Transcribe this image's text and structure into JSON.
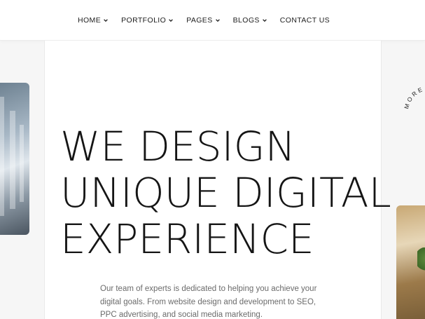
{
  "nav": {
    "items": [
      {
        "label": "HOME",
        "has_dropdown": true
      },
      {
        "label": "PORTFOLIO",
        "has_dropdown": true
      },
      {
        "label": "PAGES",
        "has_dropdown": true
      },
      {
        "label": "BLOGS",
        "has_dropdown": true
      },
      {
        "label": "CONTACT US",
        "has_dropdown": false
      }
    ]
  },
  "hero": {
    "title_line1": "WE DESIGN",
    "title_line2": "UNIQUE DIGITAL",
    "title_line3": "EXPERIENCE",
    "description": "Our team of experts is dedicated to helping you achieve your digital goals. From website design and development to SEO, PPC advertising, and social media marketing."
  },
  "badge": {
    "circular_text": "MORE · E"
  },
  "icons": {
    "dropdown": "chevron-down-icon"
  },
  "colors": {
    "text": "#151515",
    "muted": "#6b6b6b",
    "background": "#f6f6f6",
    "panel": "#ffffff"
  }
}
